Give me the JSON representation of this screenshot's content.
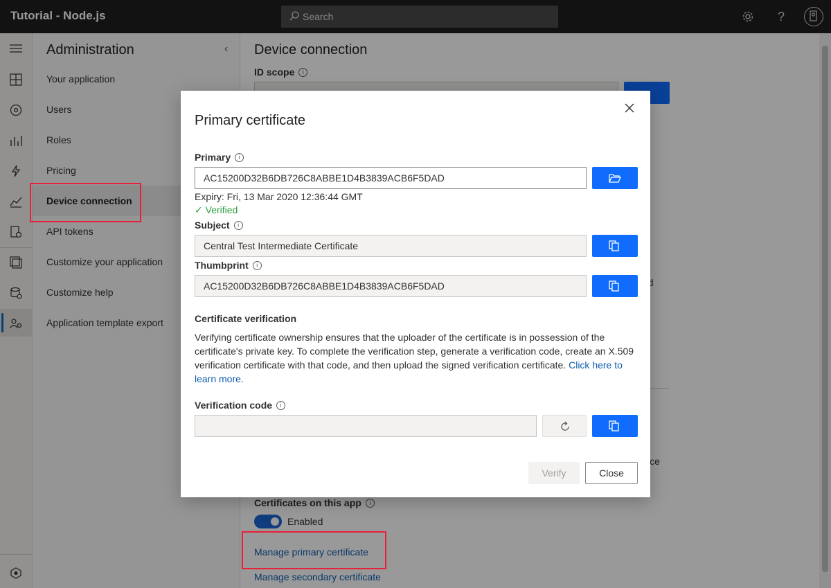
{
  "header": {
    "title": "Tutorial - Node.js",
    "search_placeholder": "Search"
  },
  "rail": {
    "icons": [
      "menu-icon",
      "dashboard-icon",
      "devices-icon",
      "analytics-icon",
      "rules-icon",
      "chart-icon",
      "jobs-icon",
      "device-templates-icon",
      "data-export-icon",
      "administration-icon",
      "app-icon"
    ]
  },
  "adminnav": {
    "title": "Administration",
    "items": [
      {
        "label": "Your application"
      },
      {
        "label": "Users"
      },
      {
        "label": "Roles"
      },
      {
        "label": "Pricing"
      },
      {
        "label": "Device connection"
      },
      {
        "label": "API tokens"
      },
      {
        "label": "Customize your application"
      },
      {
        "label": "Customize help"
      },
      {
        "label": "Application template export"
      }
    ]
  },
  "main": {
    "title": "Device connection",
    "id_scope_label": "ID scope",
    "behind_text_1": "ed",
    "behind_text_2": "vice",
    "certs_label": "Certificates on this app",
    "toggle_label": "Enabled",
    "manage_primary": "Manage primary certificate",
    "manage_secondary": "Manage secondary certificate"
  },
  "dialog": {
    "title": "Primary certificate",
    "primary_label": "Primary",
    "primary_value": "AC15200D32B6DB726C8ABBE1D4B3839ACB6F5DAD",
    "expiry": "Expiry: Fri, 13 Mar 2020 12:36:44 GMT",
    "verified": "Verified",
    "subject_label": "Subject",
    "subject_value": "Central Test Intermediate Certificate",
    "thumbprint_label": "Thumbprint",
    "thumbprint_value": "AC15200D32B6DB726C8ABBE1D4B3839ACB6F5DAD",
    "verification_heading": "Certificate verification",
    "verification_text": "Verifying certificate ownership ensures that the uploader of the certificate is in possession of the certificate's private key. To complete the verification step, generate a verification code, create an X.509 verification certificate with that code, and then upload the signed verification certificate.",
    "learn_more": "Click here to learn more.",
    "verification_code_label": "Verification code",
    "verification_code_value": "",
    "verify_button": "Verify",
    "close_button": "Close"
  }
}
